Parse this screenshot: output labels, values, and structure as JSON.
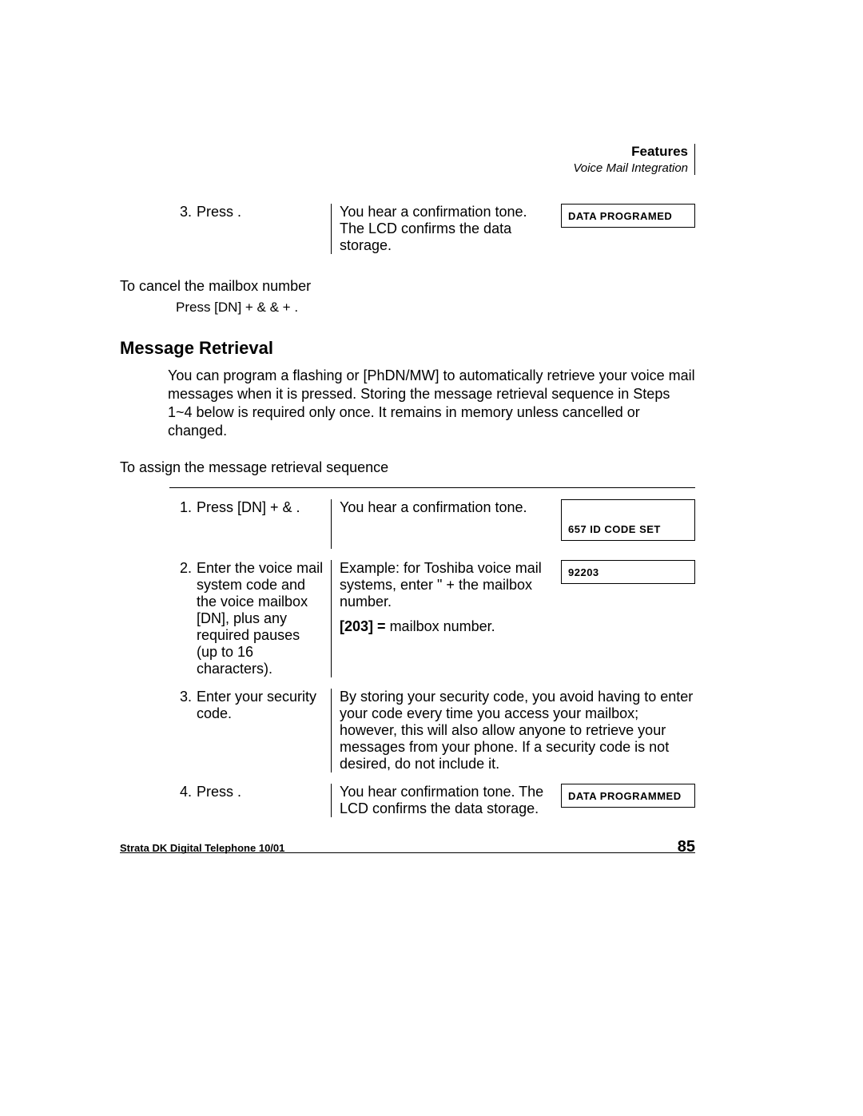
{
  "header": {
    "chapter": "Features",
    "section": "Voice Mail Integration"
  },
  "topSteps": {
    "num": "3.",
    "action": "Press      .",
    "desc": "You hear a confirmation tone. The LCD confirms the data storage.",
    "lcd": "DATA  PROGRAMED"
  },
  "cancel": {
    "title": "To cancel the mailbox number",
    "line": "Press [DN] + & & +       ."
  },
  "retrieval": {
    "title": "Message Retrieval",
    "para": "You can program a flashing     or [PhDN/MW] to automatically retrieve your voice mail messages when it is pressed. Storing the message retrieval sequence in Steps 1~4 below is required only once. It remains in memory unless cancelled or changed.",
    "assign": "To assign the message retrieval sequence",
    "steps": [
      {
        "num": "1.",
        "action": "Press [DN] + &   .",
        "desc": "You hear a confirmation tone.",
        "lcd": "657 ID CODE SET",
        "lcdTall": true
      },
      {
        "num": "2.",
        "action": "Enter the voice mail system code and the voice mailbox [DN], plus any required pauses (up to 16 characters).",
        "desc": "Example: for Toshiba voice mail systems, enter \"  + the mailbox number.",
        "extra": "[203] = mailbox number.",
        "lcd": "92203"
      },
      {
        "num": "3.",
        "action": "Enter your security code.",
        "desc": "By storing your security code, you avoid having to enter your code every time you access your mailbox; however, this will also allow anyone to retrieve your messages from your phone. If a security code is not desired, do not include it."
      },
      {
        "num": "4.",
        "action": "Press        .",
        "desc": "You hear confirmation tone. The LCD confirms the data storage.",
        "lcd": "DATA PROGRAMMED"
      }
    ]
  },
  "footer": {
    "left": "Strata DK Digital Telephone   10/01",
    "page": "85"
  }
}
